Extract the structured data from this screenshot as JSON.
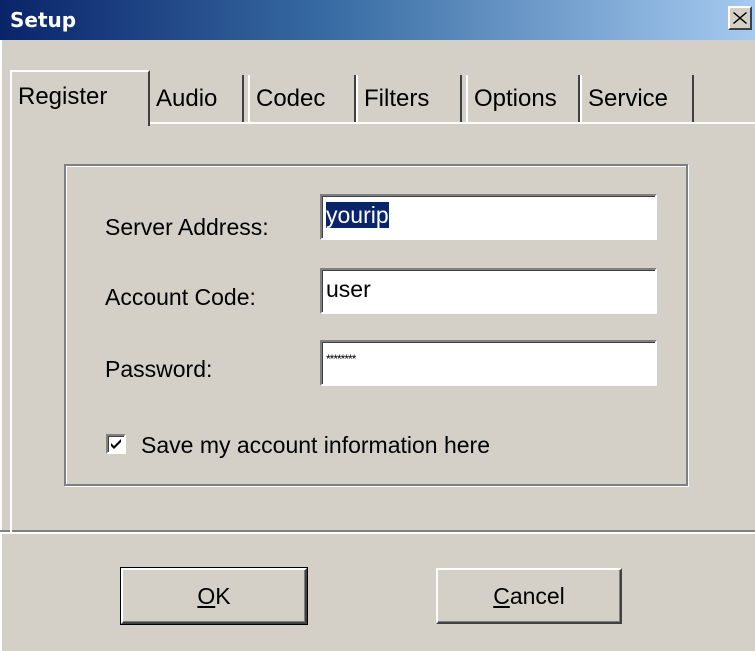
{
  "window": {
    "title": "Setup"
  },
  "tabs": [
    {
      "label": "Register",
      "active": true
    },
    {
      "label": "Audio",
      "active": false
    },
    {
      "label": "Codec",
      "active": false
    },
    {
      "label": "Filters",
      "active": false
    },
    {
      "label": "Options",
      "active": false
    },
    {
      "label": "Service",
      "active": false
    }
  ],
  "form": {
    "server_address_label": "Server Address:",
    "server_address_value": "yourip",
    "account_code_label": "Account Code:",
    "account_code_value": "user",
    "password_label": "Password:",
    "password_value": "********",
    "save_checkbox_label": "Save my account information here",
    "save_checked": true
  },
  "buttons": {
    "ok_mnemonic": "O",
    "ok_rest": "K",
    "cancel_mnemonic": "C",
    "cancel_rest": "ancel"
  },
  "colors": {
    "dialog_bg": "#d4d0c8",
    "title_start": "#0a246a",
    "title_end": "#a6caf0",
    "selection": "#0a246a"
  }
}
